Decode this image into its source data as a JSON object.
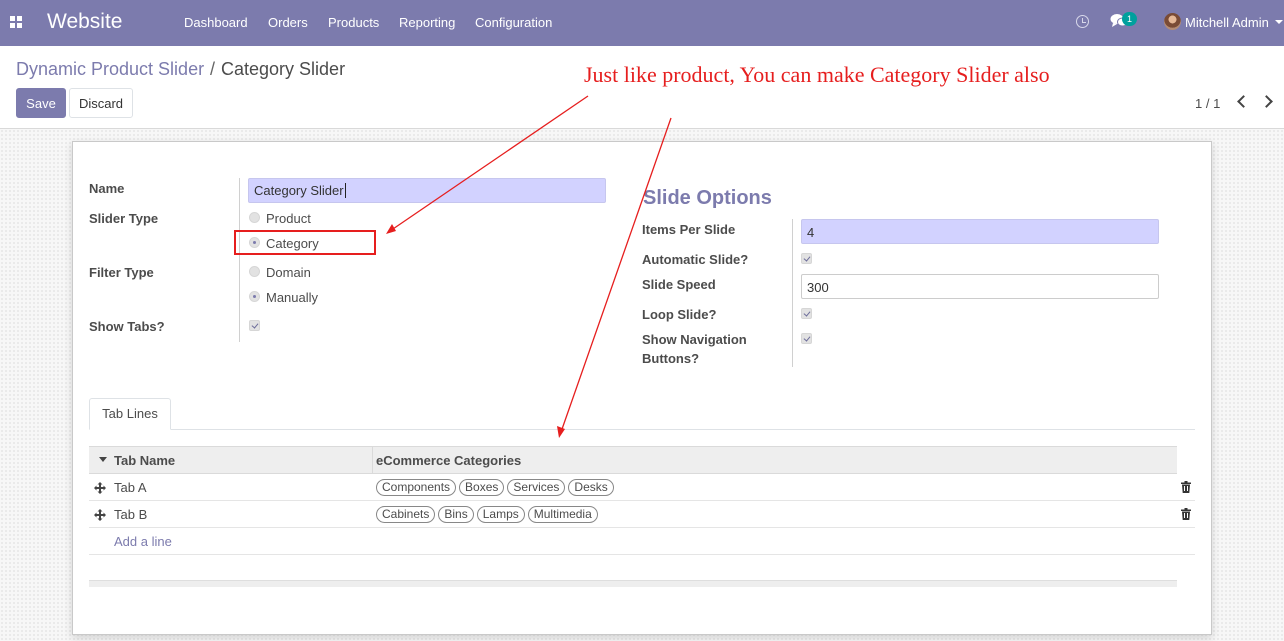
{
  "navbar": {
    "brand": "Website",
    "menu": [
      "Dashboard",
      "Orders",
      "Products",
      "Reporting",
      "Configuration"
    ],
    "chat_count": "1",
    "user_name": "Mitchell Admin",
    "color": "#7c7bad"
  },
  "control_panel": {
    "breadcrumb_parent": "Dynamic Product Slider",
    "breadcrumb_separator": "/",
    "breadcrumb_current": "Category Slider",
    "save_label": "Save",
    "discard_label": "Discard",
    "pager_value": "1 / 1"
  },
  "form": {
    "name_label": "Name",
    "name_value": "Category Slider",
    "slider_type_label": "Slider Type",
    "slider_type_options": [
      "Product",
      "Category"
    ],
    "slider_type_selected": "Category",
    "filter_type_label": "Filter Type",
    "filter_type_options": [
      "Domain",
      "Manually"
    ],
    "filter_type_selected": "Manually",
    "show_tabs_label": "Show Tabs?",
    "show_tabs_checked": true
  },
  "slide_options": {
    "title": "Slide Options",
    "items_per_slide_label": "Items Per Slide",
    "items_per_slide_value": "4",
    "automatic_slide_label": "Automatic Slide?",
    "automatic_slide_checked": true,
    "slide_speed_label": "Slide Speed",
    "slide_speed_value": "300",
    "loop_slide_label": "Loop Slide?",
    "loop_slide_checked": true,
    "show_nav_label_line1": "Show Navigation",
    "show_nav_label_line2": "Buttons?",
    "show_nav_checked": true
  },
  "tabs": [
    {
      "label": "Tab Lines",
      "active": true
    }
  ],
  "table": {
    "headers": [
      "Tab Name",
      "eCommerce Categories"
    ],
    "rows": [
      {
        "name": "Tab A",
        "categories": [
          "Components",
          "Boxes",
          "Services",
          "Desks"
        ]
      },
      {
        "name": "Tab B",
        "categories": [
          "Cabinets",
          "Bins",
          "Lamps",
          "Multimedia"
        ]
      }
    ],
    "add_line_label": "Add a line"
  },
  "annotation": {
    "text": "Just like product, You can make Category Slider also",
    "color": "#e61e1e"
  }
}
